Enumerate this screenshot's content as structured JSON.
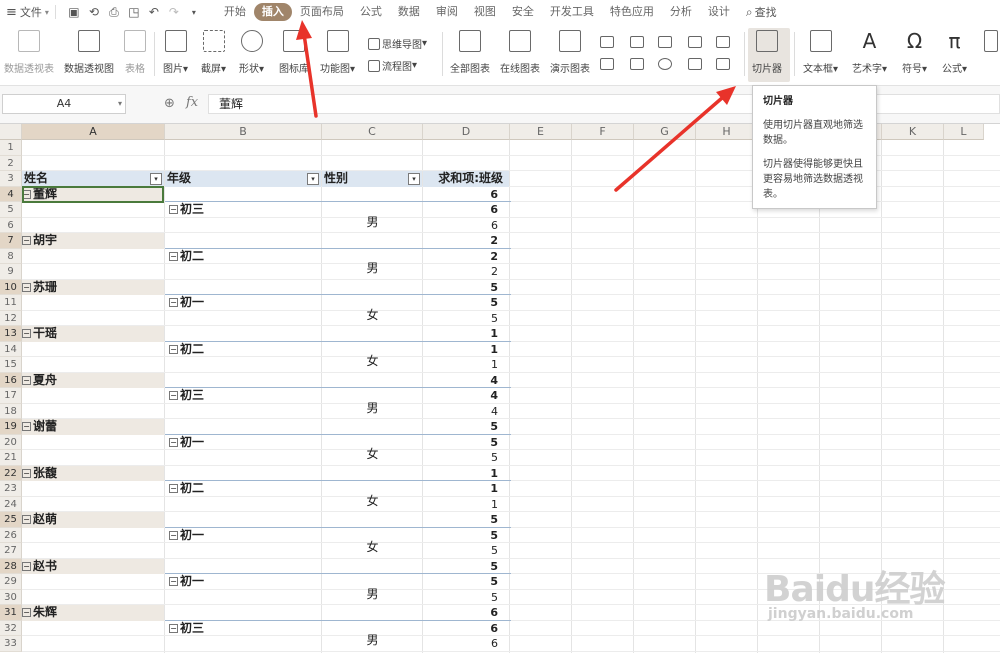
{
  "menubar": {
    "file_label": "文件",
    "tabs": [
      {
        "label": "开始",
        "active": false
      },
      {
        "label": "插入",
        "active": true
      },
      {
        "label": "页面布局",
        "active": false
      },
      {
        "label": "公式",
        "active": false
      },
      {
        "label": "数据",
        "active": false
      },
      {
        "label": "审阅",
        "active": false
      },
      {
        "label": "视图",
        "active": false
      },
      {
        "label": "安全",
        "active": false
      },
      {
        "label": "开发工具",
        "active": false
      },
      {
        "label": "特色应用",
        "active": false
      },
      {
        "label": "分析",
        "active": false
      },
      {
        "label": "设计",
        "active": false
      }
    ],
    "search_label": "查找"
  },
  "ribbon": {
    "pivot_table": "数据透视表",
    "pivot_chart": "数据透视图",
    "table": "表格",
    "picture": "图片",
    "screenshot": "截屏",
    "shape": "形状",
    "icon_lib": "图标库",
    "function_chart": "功能图",
    "mindmap": "思维导图",
    "flowchart": "流程图",
    "all_charts": "全部图表",
    "online_charts": "在线图表",
    "demo_charts": "演示图表",
    "slicer": "切片器",
    "textbox": "文本框",
    "wordart": "艺术字",
    "symbol": "符号",
    "formula": "公式"
  },
  "formula_bar": {
    "name_box": "A4",
    "fx": "fx",
    "value": "董辉"
  },
  "grid": {
    "columns": [
      "A",
      "B",
      "C",
      "D",
      "E",
      "F",
      "G",
      "H",
      "I",
      "J",
      "K",
      "L"
    ],
    "rows": [
      "1",
      "2",
      "3",
      "4",
      "5",
      "6",
      "7",
      "8",
      "9",
      "10",
      "11",
      "12",
      "13",
      "14",
      "15",
      "16",
      "17",
      "18",
      "19",
      "20",
      "21",
      "22",
      "23",
      "24",
      "25",
      "26",
      "27",
      "28",
      "29",
      "30",
      "31",
      "32",
      "33"
    ],
    "headers": {
      "name": "姓名",
      "grade": "年级",
      "gender": "性别",
      "sum": "求和项:班级"
    },
    "groups": [
      {
        "name": "董辉",
        "total": "6",
        "grade": "初三",
        "grade_total": "6",
        "gender": "男",
        "value": "6"
      },
      {
        "name": "胡宇",
        "total": "2",
        "grade": "初二",
        "grade_total": "2",
        "gender": "男",
        "value": "2"
      },
      {
        "name": "苏珊",
        "total": "5",
        "grade": "初一",
        "grade_total": "5",
        "gender": "女",
        "value": "5"
      },
      {
        "name": "干瑶",
        "total": "1",
        "grade": "初二",
        "grade_total": "1",
        "gender": "女",
        "value": "1"
      },
      {
        "name": "夏舟",
        "total": "4",
        "grade": "初三",
        "grade_total": "4",
        "gender": "男",
        "value": "4"
      },
      {
        "name": "谢蕾",
        "total": "5",
        "grade": "初一",
        "grade_total": "5",
        "gender": "女",
        "value": "5"
      },
      {
        "name": "张馥",
        "total": "1",
        "grade": "初二",
        "grade_total": "1",
        "gender": "女",
        "value": "1"
      },
      {
        "name": "赵萌",
        "total": "5",
        "grade": "初一",
        "grade_total": "5",
        "gender": "女",
        "value": "5"
      },
      {
        "name": "赵书",
        "total": "5",
        "grade": "初一",
        "grade_total": "5",
        "gender": "男",
        "value": "5"
      },
      {
        "name": "朱辉",
        "total": "6",
        "grade": "初三",
        "grade_total": "6",
        "gender": "男",
        "value": "6"
      }
    ]
  },
  "tooltip": {
    "title": "切片器",
    "line1": "使用切片器直观地筛选数据。",
    "line2": "切片器使得能够更快且更容易地筛选数据透视表。"
  },
  "watermark": {
    "brand": "Baidu经验",
    "url": "jingyan.baidu.com"
  },
  "colors": {
    "active_tab": "#a0856a",
    "header_fill": "#dce6f1",
    "name_row_fill": "#eee9e2",
    "arrow": "#e8332a"
  }
}
